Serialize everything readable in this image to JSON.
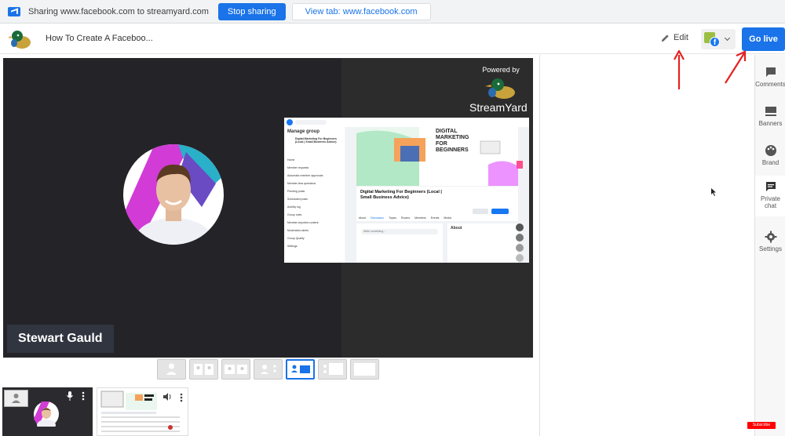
{
  "share_bar": {
    "text": "Sharing www.facebook.com to streamyard.com",
    "stop_label": "Stop sharing",
    "view_tab_label": "View tab: www.facebook.com"
  },
  "header": {
    "broadcast_title": "How To Create A Faceboo...",
    "edit_label": "Edit",
    "go_live_label": "Go live"
  },
  "stage": {
    "powered_by": "Powered by",
    "brand_name": "StreamYard",
    "name_tag": "Stewart Gauld",
    "shared_screen": {
      "sidebar_title": "Manage group",
      "group_name": "Digital Marketing For Beginners (Local | Small Business Advice)",
      "banner_line1": "DIGITAL",
      "banner_line2": "MARKETING",
      "banner_line3": "FOR",
      "banner_line4": "BEGINNERS",
      "search_placeholder": "Write something...",
      "about_heading": "About",
      "sidebar_items": [
        "Home",
        "Member requests",
        "Automatic member approvals",
        "Member-less questions",
        "Pending posts",
        "Scheduled posts",
        "Activity log",
        "Group rules",
        "Member-reported content",
        "Moderation alerts",
        "Group Quality",
        "Settings"
      ],
      "tabs": [
        "About",
        "Discussion",
        "Topics",
        "Rooms",
        "Members",
        "Events",
        "Media"
      ]
    }
  },
  "sidebar": {
    "items": [
      {
        "label": "Comments",
        "icon": "comment-icon"
      },
      {
        "label": "Banners",
        "icon": "banner-icon"
      },
      {
        "label": "Brand",
        "icon": "palette-icon"
      },
      {
        "label": "Private chat",
        "icon": "chat-icon"
      },
      {
        "label": "Settings",
        "icon": "gear-icon"
      }
    ]
  },
  "youtube_subscribe_label": "Subscribe",
  "colors": {
    "accent": "#1a73e8",
    "stage_bg": "#242428",
    "name_tag_bg": "#30353f",
    "facebook_blue": "#1877f2"
  }
}
